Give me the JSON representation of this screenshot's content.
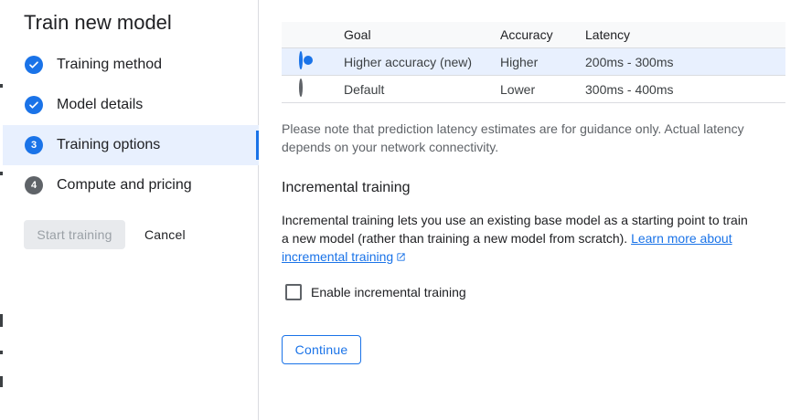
{
  "dialog": {
    "title": "Train new model"
  },
  "steps": [
    {
      "label": "Training method",
      "status": "done",
      "icon": "check-icon"
    },
    {
      "label": "Model details",
      "status": "done",
      "icon": "check-icon"
    },
    {
      "label": "Training options",
      "status": "current",
      "number": "3"
    },
    {
      "label": "Compute and pricing",
      "status": "todo",
      "number": "4"
    }
  ],
  "actions": {
    "start_label": "Start training",
    "cancel_label": "Cancel",
    "continue_label": "Continue"
  },
  "table": {
    "headers": {
      "goal": "Goal",
      "accuracy": "Accuracy",
      "latency": "Latency"
    },
    "rows": [
      {
        "goal": "Higher accuracy (new)",
        "accuracy": "Higher",
        "latency": "200ms - 300ms",
        "selected": true
      },
      {
        "goal": "Default",
        "accuracy": "Lower",
        "latency": "300ms - 400ms",
        "selected": false
      }
    ]
  },
  "note": "Please note that prediction latency estimates are for guidance only. Actual latency depends on your network connectivity.",
  "incremental": {
    "title": "Incremental training",
    "desc_prefix": "Incremental training lets you use an existing base model as a starting point to train a new model (rather than training a new model from scratch). ",
    "link_label": "Learn more about incremental training",
    "checkbox_label": "Enable incremental training",
    "checked": false
  },
  "colors": {
    "accent": "#1a73e8",
    "selected_bg": "#e8f0fe",
    "muted": "#5f6368"
  }
}
